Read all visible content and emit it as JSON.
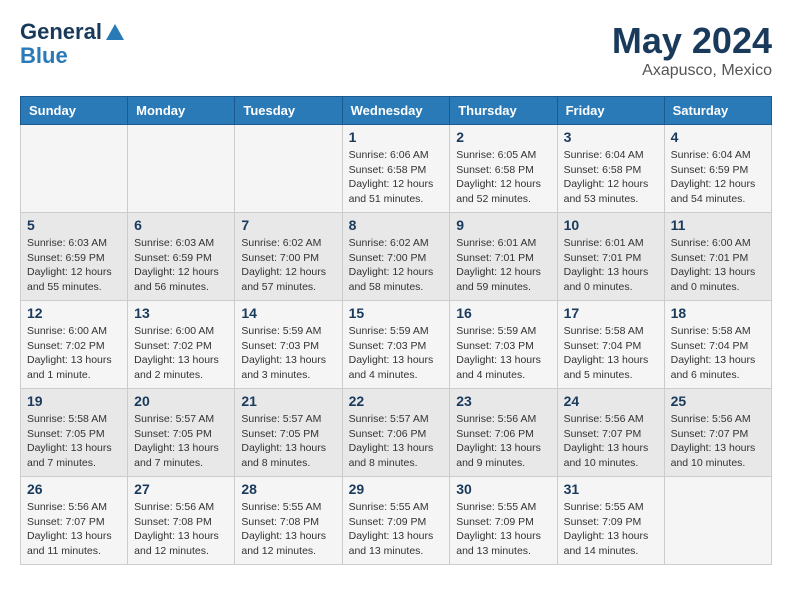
{
  "header": {
    "logo_line1": "General",
    "logo_line2": "Blue",
    "month_year": "May 2024",
    "location": "Axapusco, Mexico"
  },
  "days_of_week": [
    "Sunday",
    "Monday",
    "Tuesday",
    "Wednesday",
    "Thursday",
    "Friday",
    "Saturday"
  ],
  "weeks": [
    [
      {
        "day": "",
        "info": ""
      },
      {
        "day": "",
        "info": ""
      },
      {
        "day": "",
        "info": ""
      },
      {
        "day": "1",
        "info": "Sunrise: 6:06 AM\nSunset: 6:58 PM\nDaylight: 12 hours\nand 51 minutes."
      },
      {
        "day": "2",
        "info": "Sunrise: 6:05 AM\nSunset: 6:58 PM\nDaylight: 12 hours\nand 52 minutes."
      },
      {
        "day": "3",
        "info": "Sunrise: 6:04 AM\nSunset: 6:58 PM\nDaylight: 12 hours\nand 53 minutes."
      },
      {
        "day": "4",
        "info": "Sunrise: 6:04 AM\nSunset: 6:59 PM\nDaylight: 12 hours\nand 54 minutes."
      }
    ],
    [
      {
        "day": "5",
        "info": "Sunrise: 6:03 AM\nSunset: 6:59 PM\nDaylight: 12 hours\nand 55 minutes."
      },
      {
        "day": "6",
        "info": "Sunrise: 6:03 AM\nSunset: 6:59 PM\nDaylight: 12 hours\nand 56 minutes."
      },
      {
        "day": "7",
        "info": "Sunrise: 6:02 AM\nSunset: 7:00 PM\nDaylight: 12 hours\nand 57 minutes."
      },
      {
        "day": "8",
        "info": "Sunrise: 6:02 AM\nSunset: 7:00 PM\nDaylight: 12 hours\nand 58 minutes."
      },
      {
        "day": "9",
        "info": "Sunrise: 6:01 AM\nSunset: 7:01 PM\nDaylight: 12 hours\nand 59 minutes."
      },
      {
        "day": "10",
        "info": "Sunrise: 6:01 AM\nSunset: 7:01 PM\nDaylight: 13 hours\nand 0 minutes."
      },
      {
        "day": "11",
        "info": "Sunrise: 6:00 AM\nSunset: 7:01 PM\nDaylight: 13 hours\nand 0 minutes."
      }
    ],
    [
      {
        "day": "12",
        "info": "Sunrise: 6:00 AM\nSunset: 7:02 PM\nDaylight: 13 hours\nand 1 minute."
      },
      {
        "day": "13",
        "info": "Sunrise: 6:00 AM\nSunset: 7:02 PM\nDaylight: 13 hours\nand 2 minutes."
      },
      {
        "day": "14",
        "info": "Sunrise: 5:59 AM\nSunset: 7:03 PM\nDaylight: 13 hours\nand 3 minutes."
      },
      {
        "day": "15",
        "info": "Sunrise: 5:59 AM\nSunset: 7:03 PM\nDaylight: 13 hours\nand 4 minutes."
      },
      {
        "day": "16",
        "info": "Sunrise: 5:59 AM\nSunset: 7:03 PM\nDaylight: 13 hours\nand 4 minutes."
      },
      {
        "day": "17",
        "info": "Sunrise: 5:58 AM\nSunset: 7:04 PM\nDaylight: 13 hours\nand 5 minutes."
      },
      {
        "day": "18",
        "info": "Sunrise: 5:58 AM\nSunset: 7:04 PM\nDaylight: 13 hours\nand 6 minutes."
      }
    ],
    [
      {
        "day": "19",
        "info": "Sunrise: 5:58 AM\nSunset: 7:05 PM\nDaylight: 13 hours\nand 7 minutes."
      },
      {
        "day": "20",
        "info": "Sunrise: 5:57 AM\nSunset: 7:05 PM\nDaylight: 13 hours\nand 7 minutes."
      },
      {
        "day": "21",
        "info": "Sunrise: 5:57 AM\nSunset: 7:05 PM\nDaylight: 13 hours\nand 8 minutes."
      },
      {
        "day": "22",
        "info": "Sunrise: 5:57 AM\nSunset: 7:06 PM\nDaylight: 13 hours\nand 8 minutes."
      },
      {
        "day": "23",
        "info": "Sunrise: 5:56 AM\nSunset: 7:06 PM\nDaylight: 13 hours\nand 9 minutes."
      },
      {
        "day": "24",
        "info": "Sunrise: 5:56 AM\nSunset: 7:07 PM\nDaylight: 13 hours\nand 10 minutes."
      },
      {
        "day": "25",
        "info": "Sunrise: 5:56 AM\nSunset: 7:07 PM\nDaylight: 13 hours\nand 10 minutes."
      }
    ],
    [
      {
        "day": "26",
        "info": "Sunrise: 5:56 AM\nSunset: 7:07 PM\nDaylight: 13 hours\nand 11 minutes."
      },
      {
        "day": "27",
        "info": "Sunrise: 5:56 AM\nSunset: 7:08 PM\nDaylight: 13 hours\nand 12 minutes."
      },
      {
        "day": "28",
        "info": "Sunrise: 5:55 AM\nSunset: 7:08 PM\nDaylight: 13 hours\nand 12 minutes."
      },
      {
        "day": "29",
        "info": "Sunrise: 5:55 AM\nSunset: 7:09 PM\nDaylight: 13 hours\nand 13 minutes."
      },
      {
        "day": "30",
        "info": "Sunrise: 5:55 AM\nSunset: 7:09 PM\nDaylight: 13 hours\nand 13 minutes."
      },
      {
        "day": "31",
        "info": "Sunrise: 5:55 AM\nSunset: 7:09 PM\nDaylight: 13 hours\nand 14 minutes."
      },
      {
        "day": "",
        "info": ""
      }
    ]
  ]
}
